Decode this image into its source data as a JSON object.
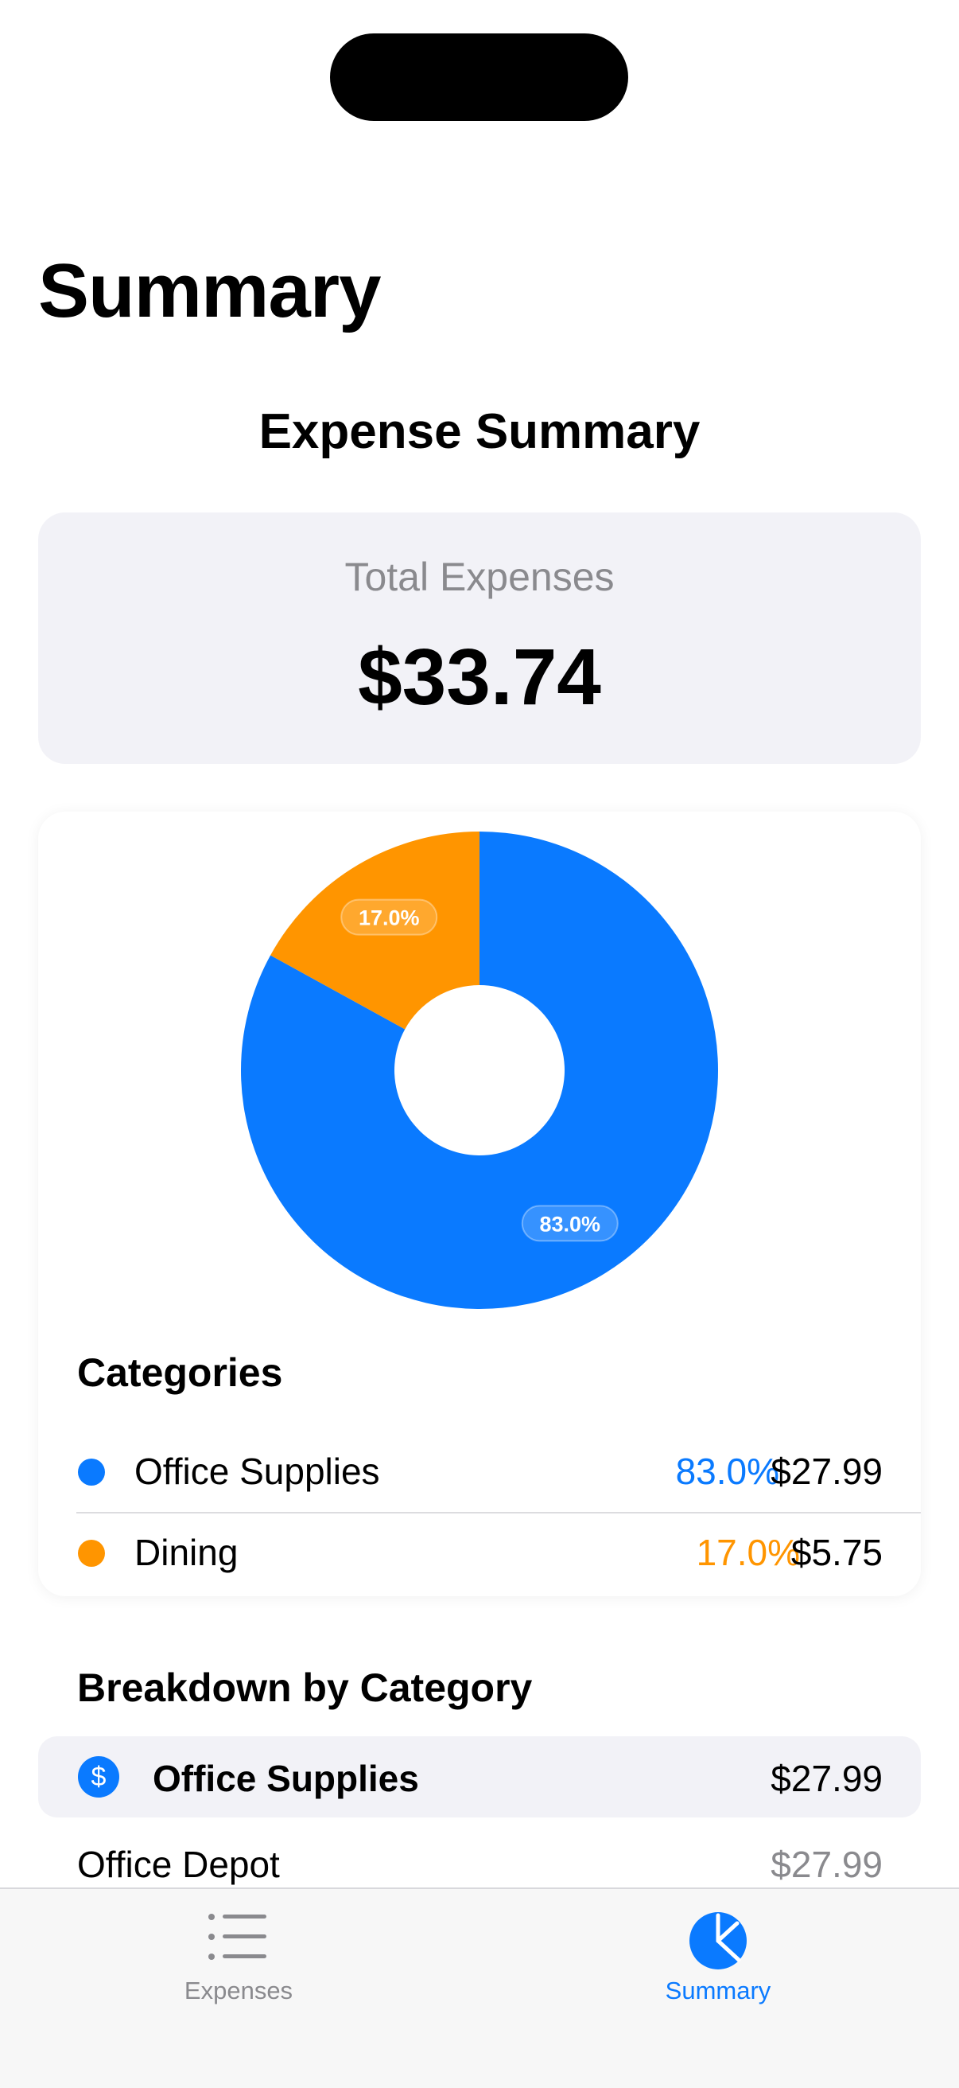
{
  "page": {
    "title": "Summary"
  },
  "summary": {
    "heading": "Expense Summary",
    "total_label": "Total Expenses",
    "total_value": "$33.74"
  },
  "colors": {
    "blue": "#0a7aff",
    "orange": "#ff9500",
    "gray_text": "#8a8a8e"
  },
  "chart_data": {
    "type": "pie",
    "categories": [
      "Office Supplies",
      "Dining"
    ],
    "values": [
      83.0,
      17.0
    ],
    "data_labels": [
      "83.0%",
      "17.0%"
    ],
    "colors": [
      "#0a7aff",
      "#ff9500"
    ],
    "donut": true
  },
  "categories": {
    "title": "Categories",
    "items": [
      {
        "name": "Office Supplies",
        "percent": "83.0%",
        "amount": "$27.99",
        "color": "#0a7aff"
      },
      {
        "name": "Dining",
        "percent": "17.0%",
        "amount": "$5.75",
        "color": "#ff9500"
      }
    ]
  },
  "breakdown": {
    "title": "Breakdown by Category",
    "groups": [
      {
        "icon": "dollar-icon",
        "icon_glyph": "$",
        "name": "Office Supplies",
        "amount": "$27.99",
        "items": [
          {
            "name": "Office Depot",
            "amount": "$27.99"
          }
        ]
      }
    ]
  },
  "tabbar": {
    "tabs": [
      {
        "label": "Expenses",
        "icon": "list-icon",
        "selected": false
      },
      {
        "label": "Summary",
        "icon": "pie-chart-icon",
        "selected": true
      }
    ]
  }
}
